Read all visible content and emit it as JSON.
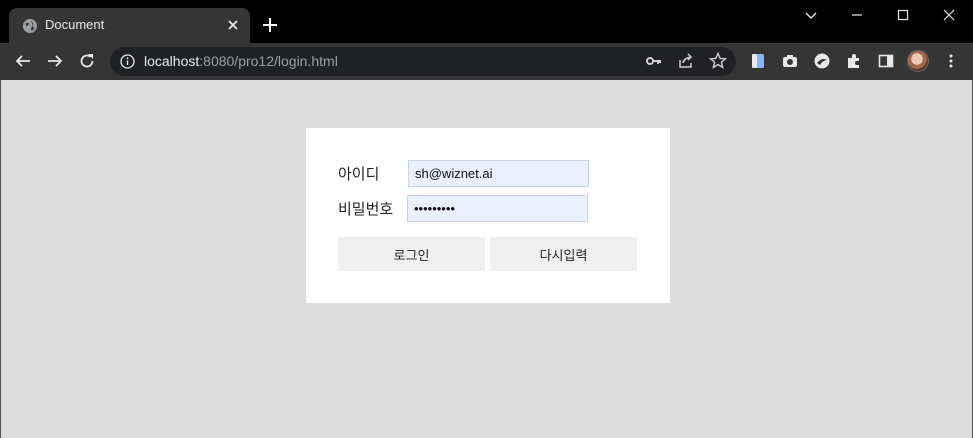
{
  "browser": {
    "tab": {
      "title": "Document",
      "favicon": "globe-icon"
    },
    "url_host": "localhost",
    "url_rest": ":8080/pro12/login.html"
  },
  "form": {
    "id_label": "아이디",
    "id_value": "sh@wiznet.ai",
    "pw_label": "비밀번호",
    "pw_value": "pass12345",
    "login_button": "로그인",
    "reset_button": "다시입력"
  },
  "colors": {
    "page_bg": "#dddddd",
    "card_bg": "#ffffff",
    "autofill_bg": "#e8f0fe",
    "button_bg": "#efefef"
  }
}
